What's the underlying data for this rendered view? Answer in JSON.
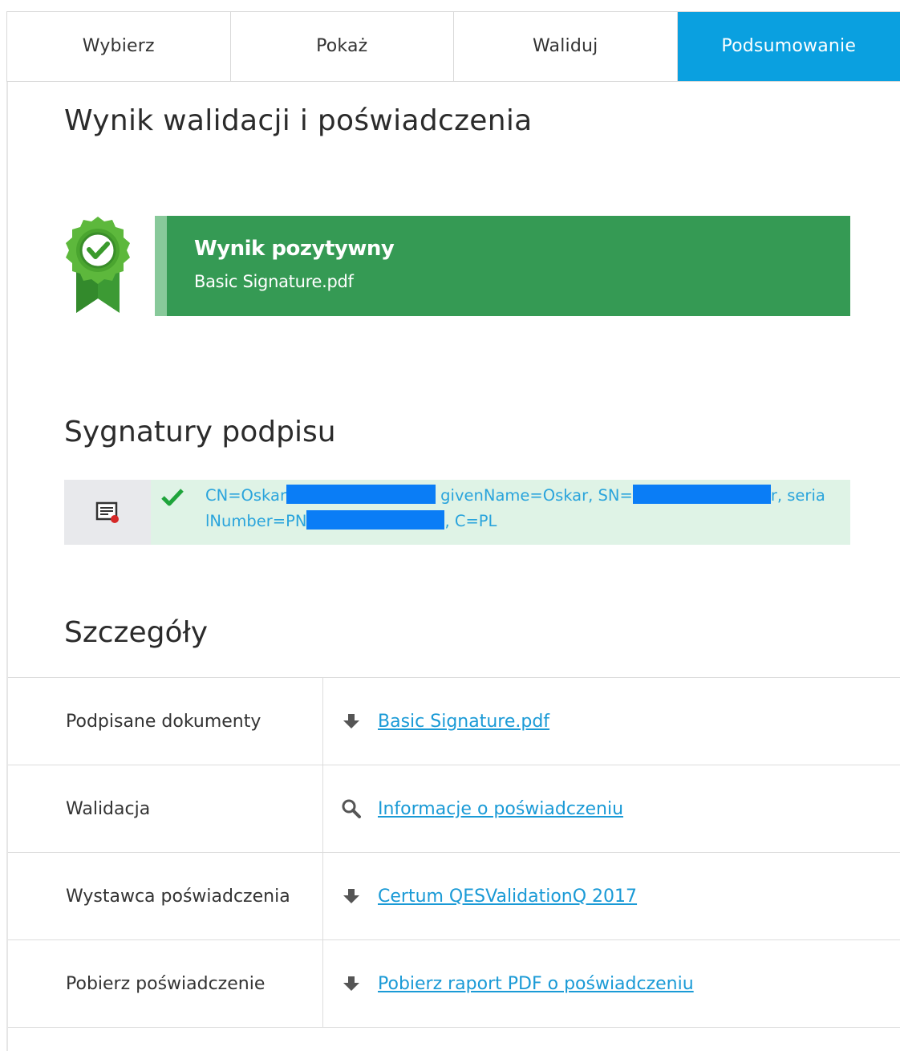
{
  "tabs": [
    {
      "label": "Wybierz",
      "active": false
    },
    {
      "label": "Pokaż",
      "active": false
    },
    {
      "label": "Waliduj",
      "active": false
    },
    {
      "label": "Podsumowanie",
      "active": true
    }
  ],
  "page_title": "Wynik walidacji i poświadczenia",
  "result": {
    "title": "Wynik pozytywny",
    "file": "Basic Signature.pdf",
    "color": "#359a54",
    "icon": "award-ribbon-check-icon"
  },
  "signatures": {
    "heading": "Sygnatury podpisu",
    "items": [
      {
        "part1": "CN=Oskar",
        "part2": " givenName=Oskar, SN=",
        "part3": "r, seria",
        "part4": "lNumber=PN",
        "part5": ", C=PL",
        "status": "valid"
      }
    ]
  },
  "details": {
    "heading": "Szczegóły",
    "rows": [
      {
        "label": "Podpisane dokumenty",
        "icon": "download-arrow-icon",
        "link": "Basic Signature.pdf"
      },
      {
        "label": "Walidacja",
        "icon": "magnifier-icon",
        "link": "Informacje o poświadczeniu"
      },
      {
        "label": "Wystawca poświadczenia",
        "icon": "download-arrow-icon",
        "link": "Certum QESValidationQ 2017"
      },
      {
        "label": "Pobierz poświadczenie",
        "icon": "download-arrow-icon",
        "link": "Pobierz raport PDF o poświadczeniu"
      }
    ]
  }
}
